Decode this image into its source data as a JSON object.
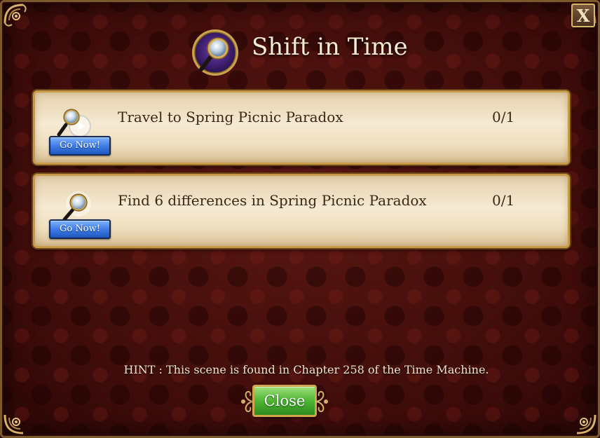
{
  "dialog": {
    "title": "Shift in Time",
    "close_x_label": "X",
    "title_icon": "magnifying-glass-icon"
  },
  "tasks": [
    {
      "description": "Travel to Spring Picnic Paradox",
      "progress": "0/1",
      "button_label": "Go Now!",
      "icon": "magnifying-glass-play-icon"
    },
    {
      "description": "Find 6 differences in Spring Picnic Paradox",
      "progress": "0/1",
      "button_label": "Go Now!",
      "icon": "magnifying-glass-icon"
    }
  ],
  "hint": "HINT : This scene is found in Chapter 258 of the Time Machine.",
  "footer": {
    "close_label": "Close"
  },
  "colors": {
    "background": "#4a100d",
    "card": "#f6ead2",
    "gold_border": "#c79a47",
    "go_now_button": "#3f7ee6",
    "close_button": "#4fb534",
    "title_text": "#f7ecd2",
    "task_text": "#3a2714"
  }
}
